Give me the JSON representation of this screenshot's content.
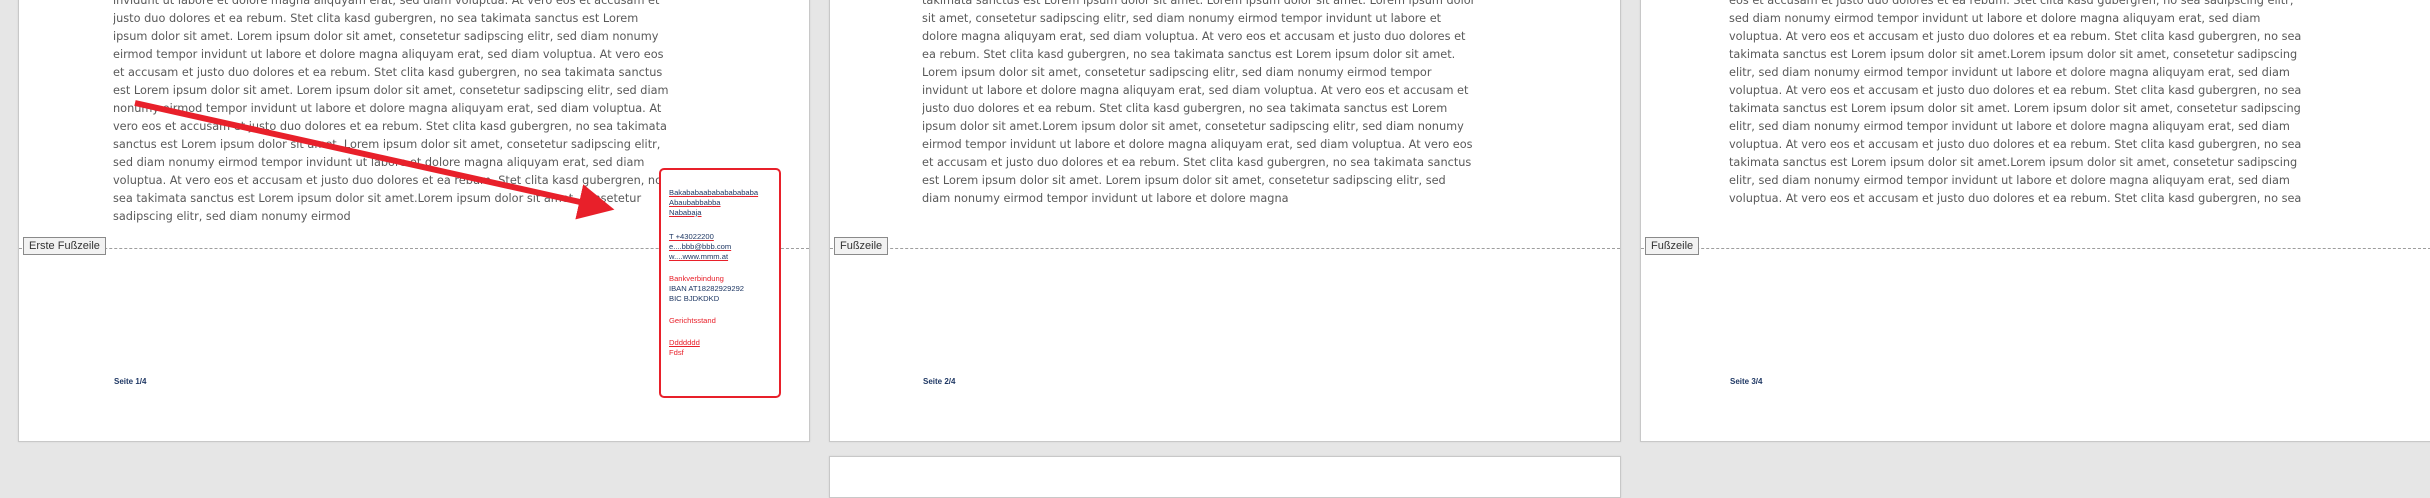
{
  "pages": [
    {
      "text": "invidunt ut labore et dolore magna aliquyam erat, sed diam voluptua. At vero eos et accusam et justo duo dolores et ea rebum. Stet clita kasd gubergren, no sea takimata sanctus est Lorem ipsum dolor sit amet. Lorem ipsum dolor sit amet, consetetur sadipscing elitr, sed diam nonumy eirmod tempor invidunt ut labore et dolore magna aliquyam erat, sed diam voluptua. At vero eos et accusam et justo duo dolores et ea rebum. Stet clita kasd gubergren, no sea takimata sanctus est Lorem ipsum dolor sit amet. Lorem ipsum dolor sit amet, consetetur sadipscing elitr, sed diam nonumy eirmod tempor invidunt ut labore et dolore magna aliquyam erat, sed diam voluptua. At vero eos et accusam et justo duo dolores et ea rebum. Stet clita kasd gubergren, no sea takimata sanctus est Lorem ipsum dolor sit amet. Lorem ipsum dolor sit amet, consetetur sadipscing elitr, sed diam nonumy eirmod tempor invidunt ut labore et dolore magna aliquyam erat, sed diam voluptua. At vero eos et accusam et justo duo dolores et ea rebum. Stet clita kasd gubergren, no sea takimata sanctus est Lorem ipsum dolor sit amet.Lorem ipsum dolor sit amet, consetetur sadipscing elitr, sed diam nonumy eirmod",
      "footer_tag": "Erste Fußzeile",
      "page_number": "Seite  1/4"
    },
    {
      "text": "takimata sanctus est Lorem ipsum dolor sit amet. Lorem ipsum dolor sit amet. Lorem ipsum dolor sit amet, consetetur sadipscing elitr, sed diam nonumy eirmod tempor invidunt ut labore et dolore magna aliquyam erat, sed diam voluptua. At vero eos et accusam et justo duo dolores et ea rebum. Stet clita kasd gubergren, no sea takimata sanctus est Lorem ipsum dolor sit amet. Lorem ipsum dolor sit amet, consetetur sadipscing elitr, sed diam nonumy eirmod tempor invidunt ut labore et dolore magna aliquyam erat, sed diam voluptua. At vero eos et accusam et justo duo dolores et ea rebum. Stet clita kasd gubergren, no sea takimata sanctus est Lorem ipsum dolor sit amet.Lorem ipsum dolor sit amet, consetetur sadipscing elitr, sed diam nonumy eirmod tempor invidunt ut labore et dolore magna aliquyam erat, sed diam voluptua. At vero eos et accusam et justo duo dolores et ea rebum. Stet clita kasd gubergren, no sea takimata sanctus est Lorem ipsum dolor sit amet. Lorem ipsum dolor sit amet, consetetur sadipscing elitr, sed diam nonumy eirmod tempor invidunt ut labore et dolore magna",
      "footer_tag": "Fußzeile",
      "page_number": "Seite  2/4"
    },
    {
      "text": "eos et accusam et justo duo dolores et ea rebum. Stet clita kasd gubergren, no sea sadipscing elitr, sed diam nonumy eirmod tempor invidunt ut labore et dolore magna aliquyam erat, sed diam voluptua. At vero eos et accusam et justo duo dolores et ea rebum. Stet clita kasd gubergren, no sea takimata sanctus est Lorem ipsum dolor sit amet.Lorem ipsum dolor sit amet, consetetur sadipscing elitr, sed diam nonumy eirmod tempor invidunt ut labore et dolore magna aliquyam erat, sed diam voluptua. At vero eos et accusam et justo duo dolores et ea rebum. Stet clita kasd gubergren, no sea takimata sanctus est Lorem ipsum dolor sit amet. Lorem ipsum dolor sit amet, consetetur sadipscing elitr, sed diam nonumy eirmod tempor invidunt ut labore et dolore magna aliquyam erat, sed diam voluptua. At vero eos et accusam et justo duo dolores et ea rebum. Stet clita kasd gubergren, no sea takimata sanctus est Lorem ipsum dolor sit amet.Lorem ipsum dolor sit amet, consetetur sadipscing elitr, sed diam nonumy eirmod tempor invidunt ut labore et dolore magna aliquyam erat, sed diam voluptua. At vero eos et accusam et justo duo dolores et ea rebum. Stet clita kasd gubergren, no sea",
      "footer_tag": "Fußzeile",
      "page_number": "Seite  3/4"
    }
  ],
  "callout": {
    "address_lines": [
      "Bakababaababababababa",
      "Abaubabbabba",
      "Nababaja"
    ],
    "phone": "T +43022200",
    "email": "e....bbb@bbb.com",
    "web": "w....www.mmm.at",
    "bank_heading": "Bankverbindung",
    "iban": "IBAN  AT18282929292",
    "bic": "BIC  BJDKDKD",
    "court": "Gerichtsstand",
    "extra1": "Ddddddd",
    "extra2": "Fdsf"
  },
  "colors": {
    "accent": "#e8202a",
    "navy": "#1f3864",
    "body_text": "#595959"
  }
}
